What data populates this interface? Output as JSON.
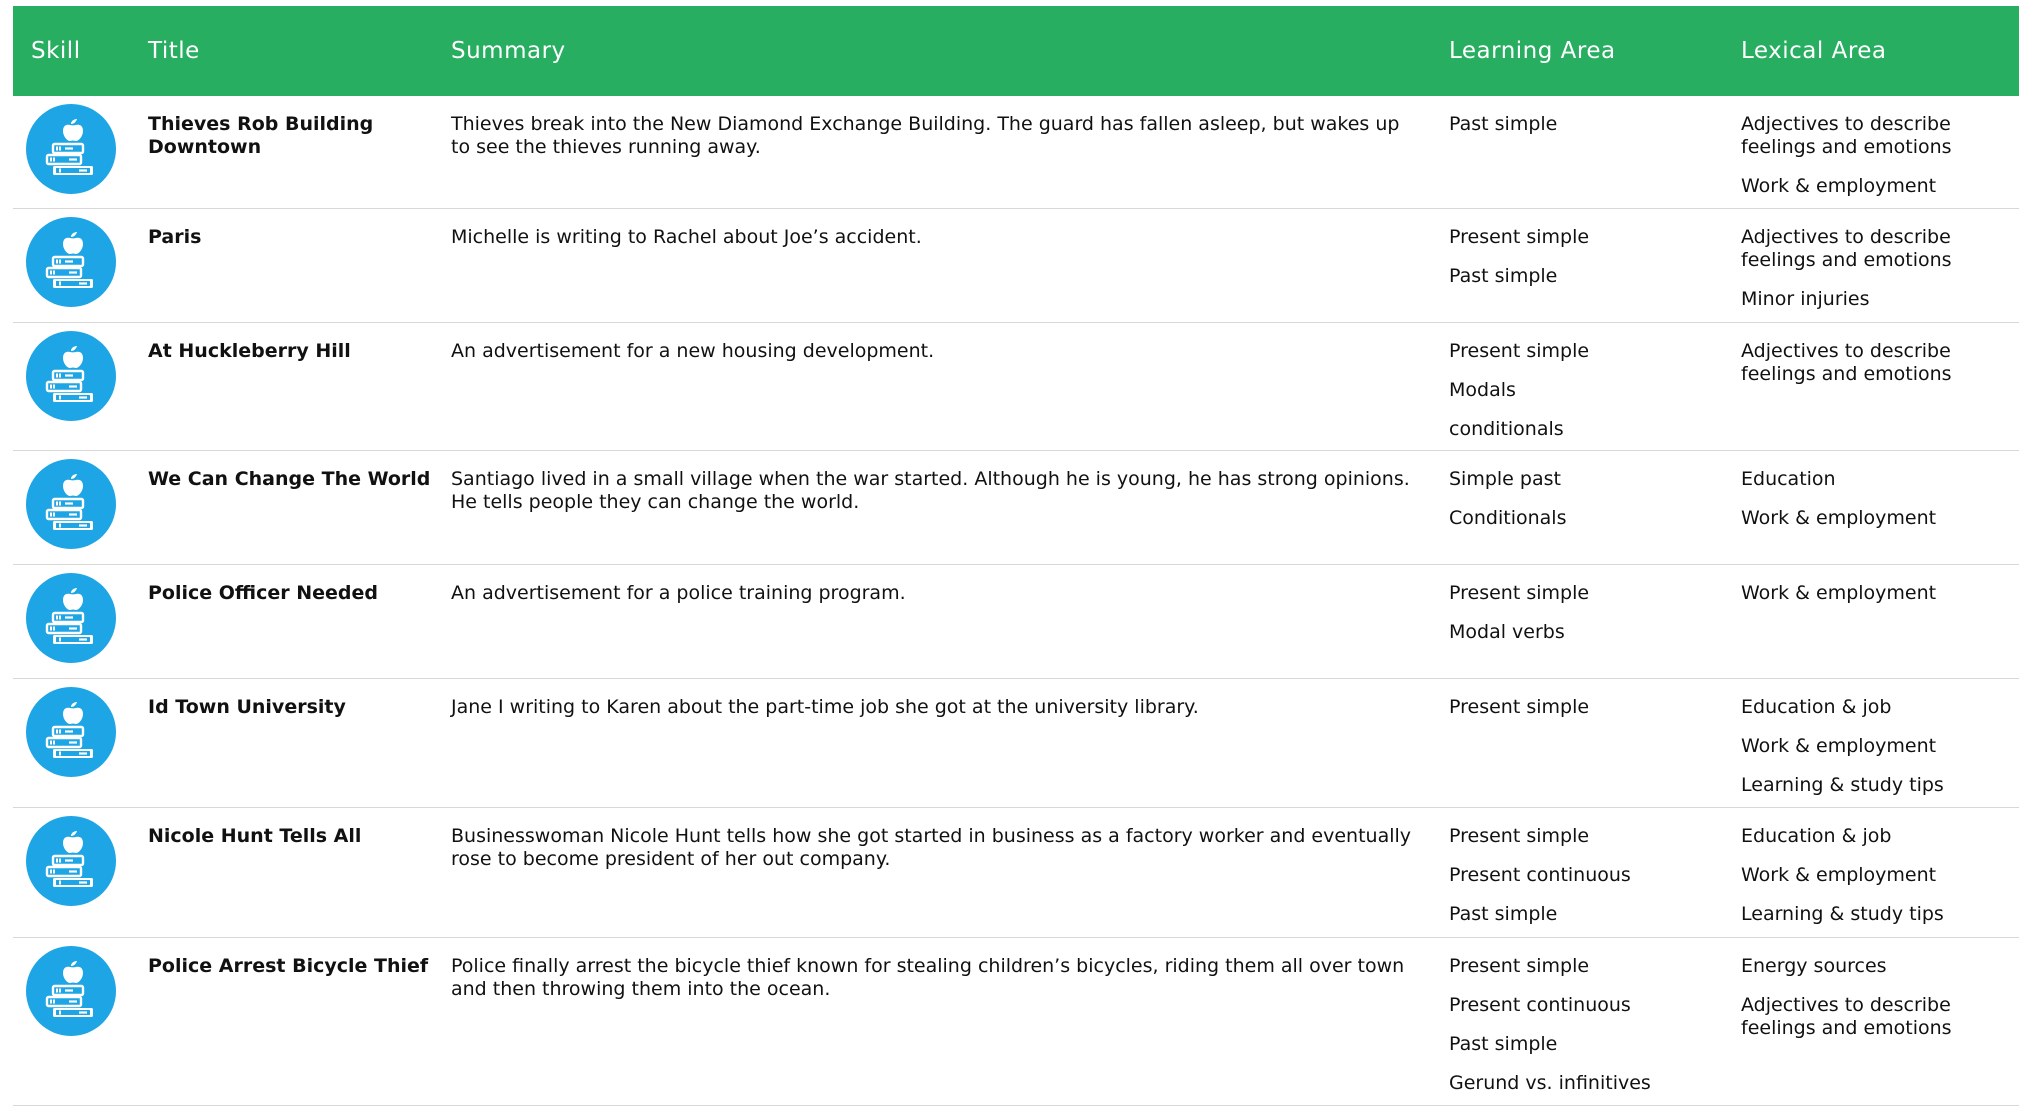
{
  "header": {
    "skill": "Skill",
    "title": "Title",
    "summary": "Summary",
    "learning_area": "Learning Area",
    "lexical_area": "Lexical Area"
  },
  "colors": {
    "header_bg": "#27ae60",
    "icon_bg": "#1ea5e5"
  },
  "rows": [
    {
      "icon": "books-apple-icon",
      "title": "Thieves Rob Building Downtown",
      "summary": "Thieves break into the New Diamond Exchange Building. The guard has fallen asleep, but wakes up to see the thieves running away.",
      "learning": [
        "Past simple"
      ],
      "lexical": [
        "Adjectives to describe feelings and emotions",
        "Work & employment"
      ]
    },
    {
      "icon": "books-apple-icon",
      "title": "Paris",
      "summary": "Michelle is writing to Rachel about Joe’s accident.",
      "learning": [
        "Present simple",
        "Past simple"
      ],
      "lexical": [
        "Adjectives to describe feelings and emotions",
        "Minor injuries"
      ]
    },
    {
      "icon": "books-apple-icon",
      "title": "At Huckleberry Hill",
      "summary": "An advertisement for a new housing development.",
      "learning": [
        "Present simple",
        "Modals",
        "conditionals"
      ],
      "lexical": [
        "Adjectives to describe feelings and emotions"
      ]
    },
    {
      "icon": "books-apple-icon",
      "title": "We Can Change The World",
      "summary": "Santiago lived in a small village when the war started. Although he is young, he has strong opinions. He tells people they can change the world.",
      "learning": [
        "Simple past",
        "Conditionals"
      ],
      "lexical": [
        "Education",
        "Work & employment"
      ]
    },
    {
      "icon": "books-apple-icon",
      "title": "Police Officer Needed",
      "summary": "An advertisement for a police training program.",
      "learning": [
        "Present simple",
        "Modal verbs"
      ],
      "lexical": [
        "Work & employment"
      ]
    },
    {
      "icon": "books-apple-icon",
      "title": "Id Town University",
      "summary": "Jane I writing to Karen about the part-time job she got at the university library.",
      "learning": [
        "Present simple"
      ],
      "lexical": [
        "Education & job",
        "Work & employment",
        "Learning & study tips"
      ]
    },
    {
      "icon": "books-apple-icon",
      "title": "Nicole Hunt Tells All",
      "summary": "Businesswoman Nicole Hunt tells how she got started in business as a factory worker and eventually rose to become president of her out company.",
      "learning": [
        "Present simple",
        "Present continuous",
        "Past simple"
      ],
      "lexical": [
        "Education & job",
        "Work & employment",
        "Learning & study tips"
      ]
    },
    {
      "icon": "books-apple-icon",
      "title": "Police Arrest Bicycle Thief",
      "summary": "Police finally arrest the bicycle thief known for stealing children’s bicycles, riding them all over town and then throwing them into the ocean.",
      "learning": [
        "Present simple",
        "Present continuous",
        "Past simple",
        "Gerund vs. infinitives"
      ],
      "lexical": [
        "Energy sources",
        "Adjectives to describe feelings and emotions"
      ]
    }
  ]
}
